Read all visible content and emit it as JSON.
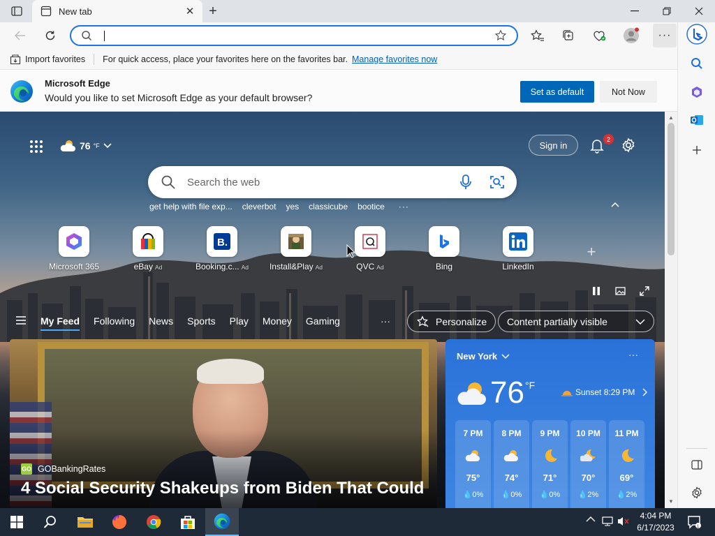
{
  "browser": {
    "tab_title": "New tab",
    "address_value": "",
    "address_placeholder": ""
  },
  "favorites_bar": {
    "import_label": "Import favorites",
    "message": "For quick access, place your favorites here on the favorites bar.",
    "manage_link": "Manage favorites now"
  },
  "default_prompt": {
    "title": "Microsoft Edge",
    "message": "Would you like to set Microsoft Edge as your default browser?",
    "primary_button": "Set as default",
    "secondary_button": "Not Now"
  },
  "header": {
    "weather_temp": "76",
    "weather_unit": "°F",
    "signin_label": "Sign in",
    "notification_count": "2"
  },
  "search": {
    "placeholder": "Search the web",
    "suggestions": [
      "get help with file exp...",
      "cleverbot",
      "yes",
      "classicube",
      "bootice"
    ],
    "more": "···"
  },
  "tiles": [
    {
      "label": "Microsoft 365",
      "ad": "",
      "icon": "microsoft-365-icon"
    },
    {
      "label": "eBay",
      "ad": "Ad",
      "icon": "ebay-icon"
    },
    {
      "label": "Booking.c...",
      "ad": "Ad",
      "icon": "booking-icon"
    },
    {
      "label": "Install&Play",
      "ad": "Ad",
      "icon": "install-play-icon"
    },
    {
      "label": "QVC",
      "ad": "Ad",
      "icon": "qvc-icon"
    },
    {
      "label": "Bing",
      "ad": "",
      "icon": "bing-icon"
    },
    {
      "label": "LinkedIn",
      "ad": "",
      "icon": "linkedin-icon"
    }
  ],
  "feed_nav": {
    "items": [
      "My Feed",
      "Following",
      "News",
      "Sports",
      "Play",
      "Money",
      "Gaming"
    ],
    "more": "···",
    "personalize": "Personalize",
    "content_visibility": "Content partially visible"
  },
  "hero": {
    "source": "GOBankingRates",
    "source_logo_text": "GO",
    "headline": "4 Social Security Shakeups from Biden That Could"
  },
  "weather_card": {
    "city": "New York",
    "temperature": "76",
    "unit": "°F",
    "sunset": "Sunset 8:29 PM",
    "hours": [
      {
        "time": "7 PM",
        "temp": "75°",
        "precip": "0%",
        "icon": "partly-cloudy-icon"
      },
      {
        "time": "8 PM",
        "temp": "74°",
        "precip": "0%",
        "icon": "partly-cloudy-icon"
      },
      {
        "time": "9 PM",
        "temp": "71°",
        "precip": "0%",
        "icon": "moon-icon"
      },
      {
        "time": "10 PM",
        "temp": "70°",
        "precip": "2%",
        "icon": "partly-cloudy-night-icon"
      },
      {
        "time": "11 PM",
        "temp": "69°",
        "precip": "2%",
        "icon": "moon-icon"
      }
    ]
  },
  "taskbar": {
    "time": "4:04 PM",
    "date": "6/17/2023"
  },
  "colors": {
    "accent": "#0067b8",
    "address_border": "#1a73e8",
    "taskbar": "#1f2a38",
    "weather_card": "#2a72d8"
  }
}
